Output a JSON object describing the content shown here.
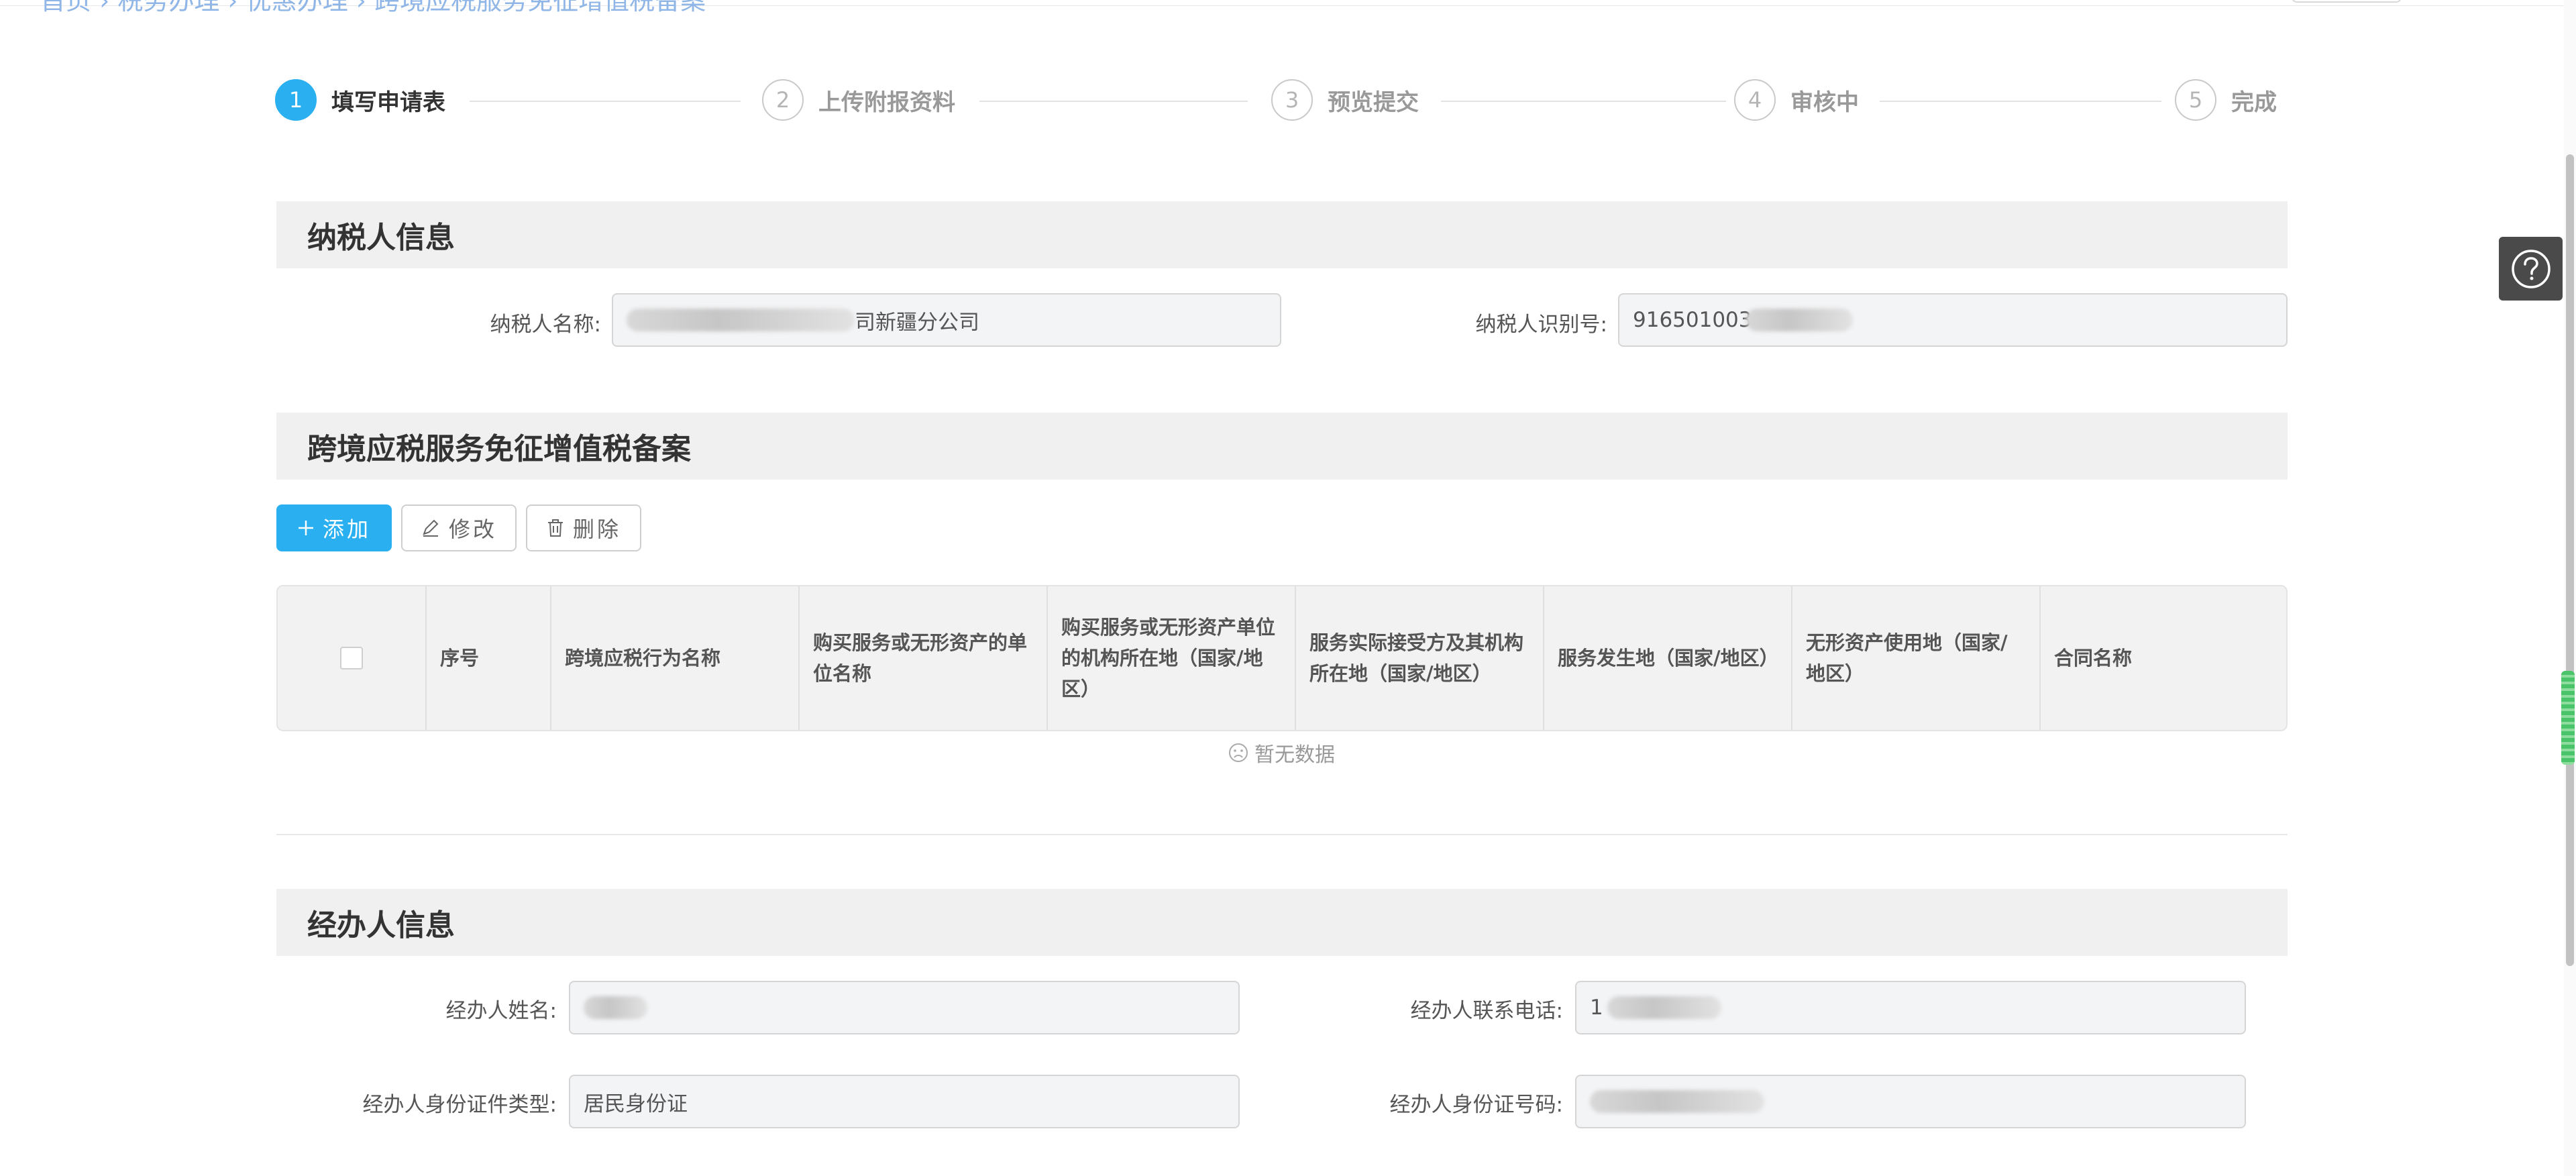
{
  "breadcrumb": {
    "partial_text": "首页 › 税务办理 › 优惠办理 › 跨境应税服务免征增值税备案"
  },
  "steps": [
    {
      "num": "1",
      "label": "填写申请表",
      "active": true
    },
    {
      "num": "2",
      "label": "上传附报资料",
      "active": false
    },
    {
      "num": "3",
      "label": "预览提交",
      "active": false
    },
    {
      "num": "4",
      "label": "审核中",
      "active": false
    },
    {
      "num": "5",
      "label": "完成",
      "active": false
    }
  ],
  "taxpayer": {
    "section_title": "纳税人信息",
    "name_label": "纳税人名称:",
    "name_value_visible": "司新疆分公司",
    "id_label": "纳税人识别号:",
    "id_value_visible": "916501003"
  },
  "filing": {
    "section_title": "跨境应税服务免征增值税备案",
    "add_label": "添加",
    "edit_label": "修改",
    "delete_label": "删除",
    "columns": [
      "",
      "序号",
      "跨境应税行为名称",
      "购买服务或无形资产的单位名称",
      "购买服务或无形资产单位的机构所在地（国家/地区）",
      "服务实际接受方及其机构所在地（国家/地区）",
      "服务发生地（国家/地区）",
      "无形资产使用地（国家/地区）",
      "合同名称"
    ],
    "empty_text": "暂无数据"
  },
  "agent": {
    "section_title": "经办人信息",
    "name_label": "经办人姓名:",
    "phone_label": "经办人联系电话:",
    "phone_value_visible": "1",
    "id_type_label": "经办人身份证件类型:",
    "id_type_value": "居民身份证",
    "id_number_label": "经办人身份证号码:"
  },
  "colors": {
    "accent": "#2ab0f0",
    "section_bg": "#f0f0f0",
    "input_bg": "#f3f4f6"
  },
  "icons": {
    "help": "question-circle-icon",
    "add": "plus-icon",
    "edit": "pencil-icon",
    "delete": "trash-icon",
    "empty": "frown-icon"
  }
}
